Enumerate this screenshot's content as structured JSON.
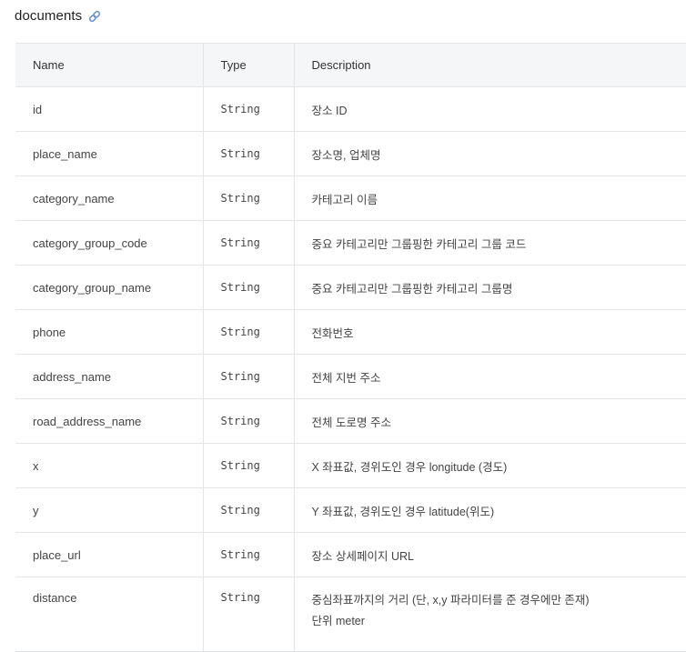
{
  "section": {
    "title": "documents",
    "icon": "link-icon"
  },
  "table": {
    "headers": [
      "Name",
      "Type",
      "Description"
    ],
    "rows": [
      {
        "name": "id",
        "type": "String",
        "description": [
          "장소 ID"
        ]
      },
      {
        "name": "place_name",
        "type": "String",
        "description": [
          "장소명, 업체명"
        ]
      },
      {
        "name": "category_name",
        "type": "String",
        "description": [
          "카테고리 이름"
        ]
      },
      {
        "name": "category_group_code",
        "type": "String",
        "description": [
          "중요 카테고리만 그룹핑한 카테고리 그룹 코드"
        ]
      },
      {
        "name": "category_group_name",
        "type": "String",
        "description": [
          "중요 카테고리만 그룹핑한 카테고리 그룹명"
        ]
      },
      {
        "name": "phone",
        "type": "String",
        "description": [
          "전화번호"
        ]
      },
      {
        "name": "address_name",
        "type": "String",
        "description": [
          "전체 지번 주소"
        ]
      },
      {
        "name": "road_address_name",
        "type": "String",
        "description": [
          "전체 도로명 주소"
        ]
      },
      {
        "name": "x",
        "type": "String",
        "description": [
          "X 좌표값, 경위도인 경우 longitude (경도)"
        ]
      },
      {
        "name": "y",
        "type": "String",
        "description": [
          "Y 좌표값, 경위도인 경우 latitude(위도)"
        ]
      },
      {
        "name": "place_url",
        "type": "String",
        "description": [
          "장소 상세페이지 URL"
        ]
      },
      {
        "name": "distance",
        "type": "String",
        "description": [
          "중심좌표까지의 거리 (단, x,y 파라미터를 준 경우에만 존재)",
          "단위 meter"
        ]
      }
    ]
  }
}
